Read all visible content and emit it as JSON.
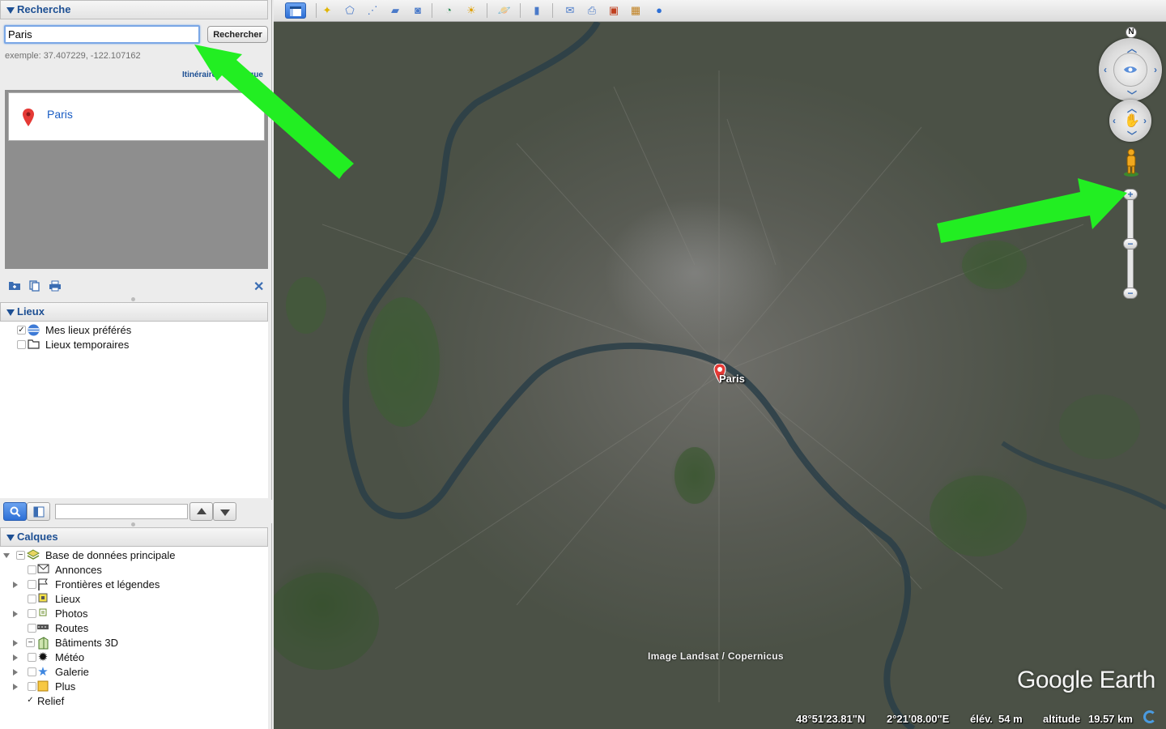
{
  "search_panel": {
    "title": "Recherche",
    "input_value": "Paris",
    "button_label": "Rechercher",
    "example": "exemple: 37.407229, -122.107162",
    "links": "Itinéraires  Historique",
    "results": [
      {
        "name": "Paris"
      }
    ]
  },
  "places_panel": {
    "title": "Lieux",
    "items": [
      {
        "label": "Mes lieux préférés",
        "icon": "globe-icon",
        "checked": true
      },
      {
        "label": "Lieux temporaires",
        "icon": "folder-icon",
        "checked": false
      }
    ]
  },
  "layers_panel": {
    "title": "Calques",
    "root": {
      "label": "Base de données principale",
      "icon": "database-icon",
      "state": "partial"
    },
    "items": [
      {
        "label": "Annonces",
        "icon": "envelope-icon",
        "expandable": false
      },
      {
        "label": "Frontières et légendes",
        "icon": "flag-icon",
        "expandable": true
      },
      {
        "label": "Lieux",
        "icon": "place-square-icon",
        "expandable": false
      },
      {
        "label": "Photos",
        "icon": "photo-icon",
        "expandable": true
      },
      {
        "label": "Routes",
        "icon": "road-icon",
        "expandable": false
      },
      {
        "label": "Bâtiments 3D",
        "icon": "building-icon",
        "expandable": true,
        "state": "partial"
      },
      {
        "label": "Météo",
        "icon": "sun-icon",
        "expandable": true
      },
      {
        "label": "Galerie",
        "icon": "star-icon",
        "expandable": true
      },
      {
        "label": "Plus",
        "icon": "note-icon",
        "expandable": true
      }
    ],
    "relief": {
      "label": "Relief",
      "checked": true
    }
  },
  "map": {
    "placemark": "Paris",
    "attribution": "Image Landsat / Copernicus",
    "brand": "Google Earth",
    "compass_letter": "N",
    "status": {
      "lat": "48°51'23.81\"N",
      "lon": "2°21'08.00\"E",
      "elev_label": "élév.",
      "elev_value": "54 m",
      "alt_label": "altitude",
      "alt_value": "19.57 km"
    }
  },
  "colors": {
    "accent_blue": "#1d4f93",
    "link_blue": "#1a5dc4",
    "annotation_green": "#22ee22",
    "marker_red": "#e53935"
  }
}
